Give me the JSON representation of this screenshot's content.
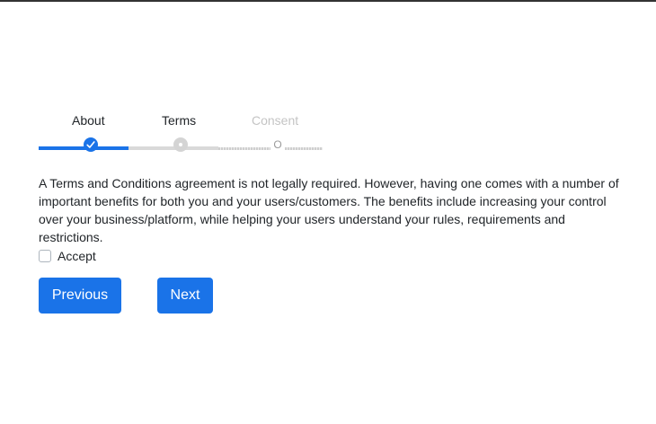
{
  "wizard": {
    "steps": [
      {
        "label": "About",
        "state": "completed"
      },
      {
        "label": "Terms",
        "state": "current"
      },
      {
        "label": "Consent",
        "state": "upcoming"
      }
    ],
    "consent_marker": "O"
  },
  "content": {
    "body": "A Terms and Conditions agreement is not legally required. However, having one comes with a number of important benefits for both you and your users/customers. The benefits include increasing your control over your business/platform, while helping your users understand your rules, requirements and restrictions."
  },
  "accept": {
    "label": "Accept",
    "checked": false
  },
  "buttons": {
    "previous_label": "Previous",
    "next_label": "Next"
  },
  "colors": {
    "accent": "#1a73e8",
    "inactive": "#d4d4d4",
    "disabled_text": "#c4c4c4"
  },
  "icons": {
    "completed": "check-icon",
    "current": "dot-icon"
  }
}
